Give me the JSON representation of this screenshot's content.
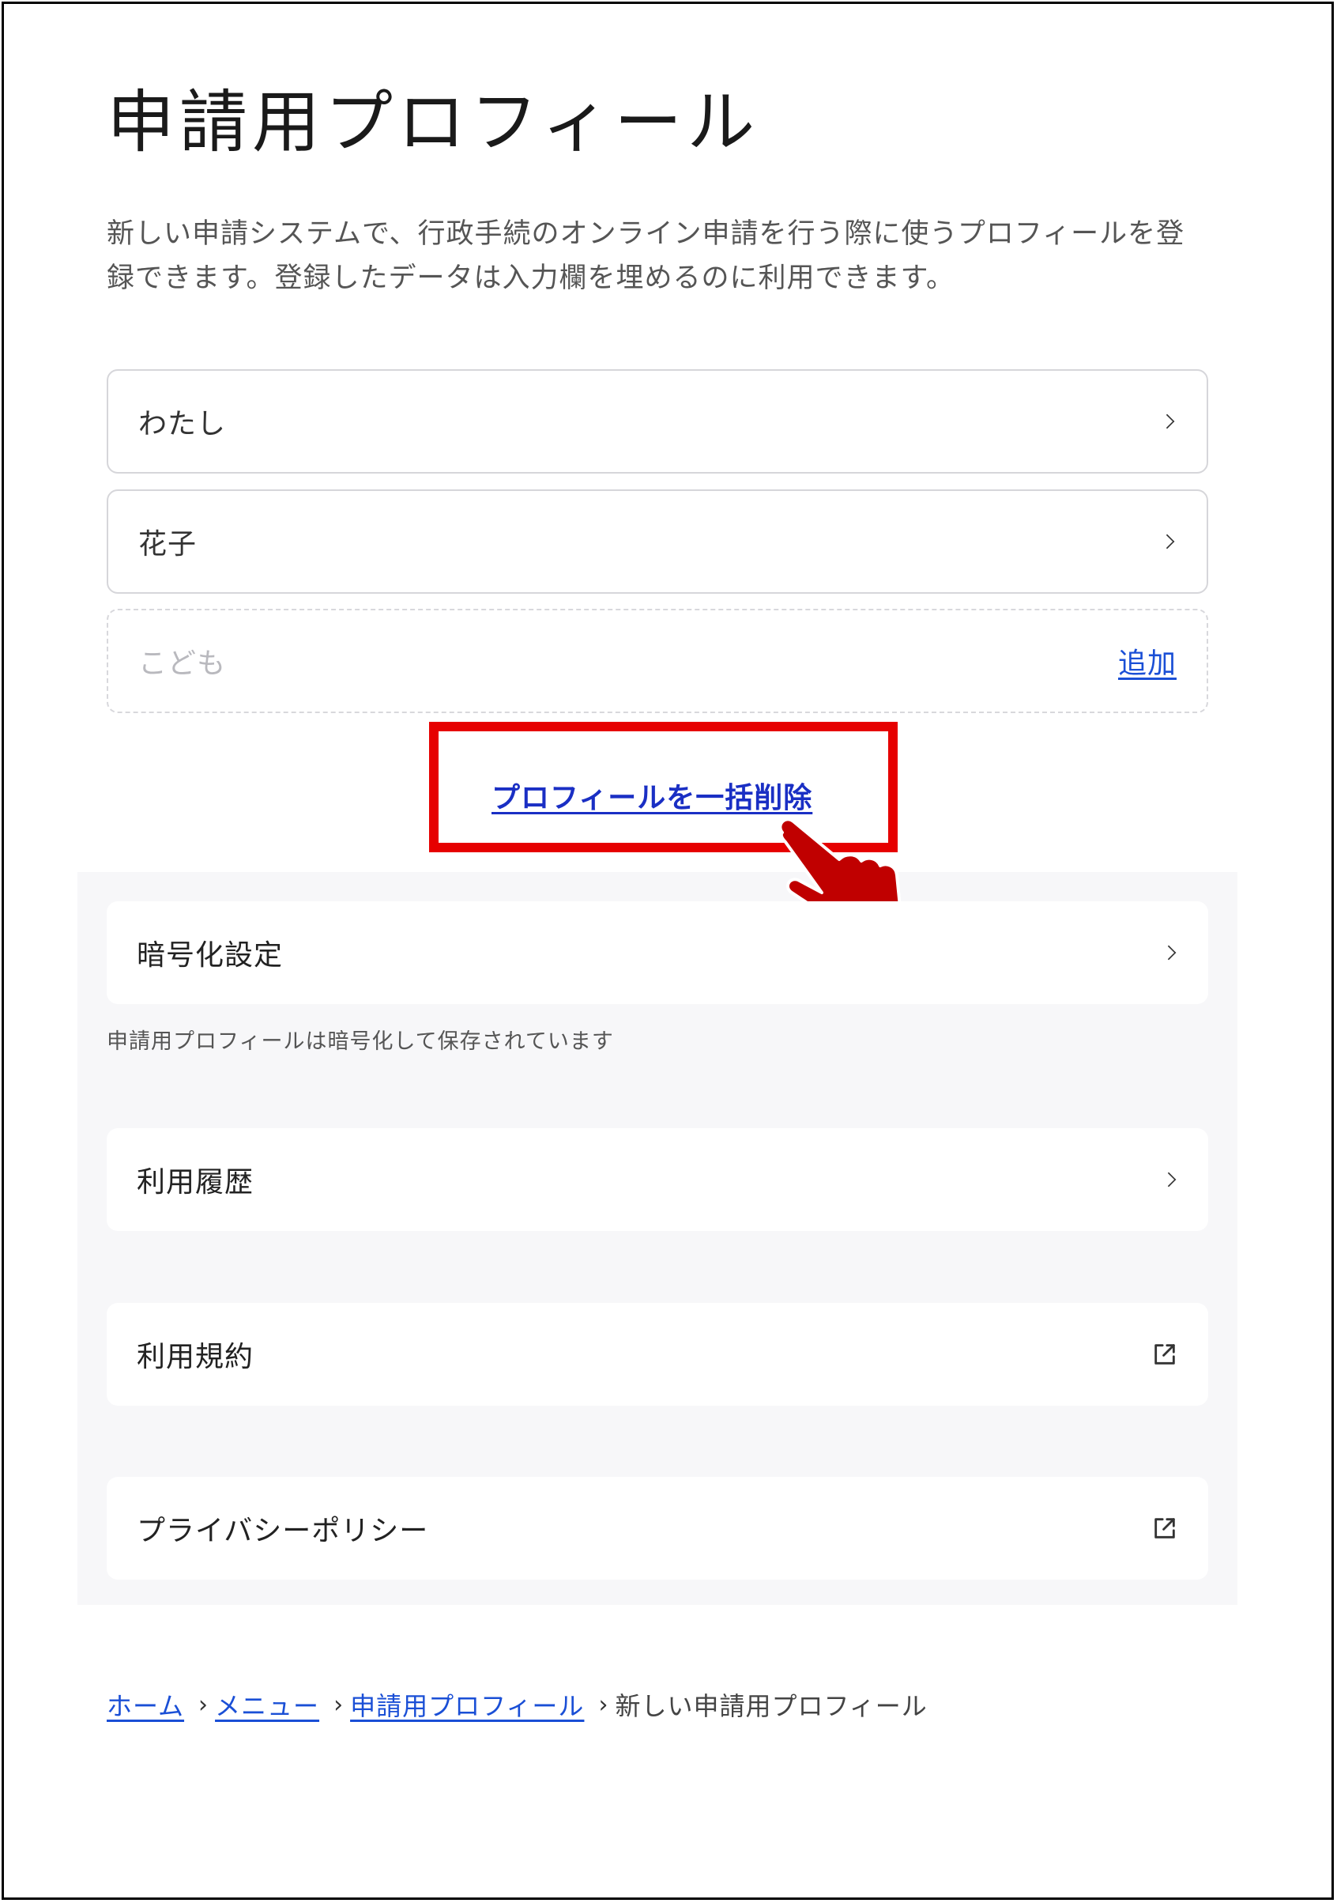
{
  "page": {
    "title": "申請用プロフィール",
    "description": "新しい申請システムで、行政手続のオンライン申請を行う際に使うプロフィールを登録できます。登録したデータは入力欄を埋めるのに利用できます。"
  },
  "profiles": [
    {
      "label": "わたし"
    },
    {
      "label": "花子"
    }
  ],
  "add_profile": {
    "placeholder": "こども",
    "action_label": "追加"
  },
  "bulk_delete": {
    "label": "プロフィールを一括削除"
  },
  "settings": {
    "encryption": {
      "label": "暗号化設定",
      "note": "申請用プロフィールは暗号化して保存されています"
    },
    "history": {
      "label": "利用履歴"
    },
    "terms": {
      "label": "利用規約"
    },
    "privacy": {
      "label": "プライバシーポリシー"
    }
  },
  "breadcrumb": {
    "items": [
      "ホーム",
      "メニュー",
      "申請用プロフィール"
    ],
    "current": "新しい申請用プロフィール",
    "separator": "›"
  },
  "colors": {
    "link": "#1a4fd6",
    "highlight": "#e60000",
    "hand": "#c00000",
    "panel": "#f7f7f9"
  }
}
